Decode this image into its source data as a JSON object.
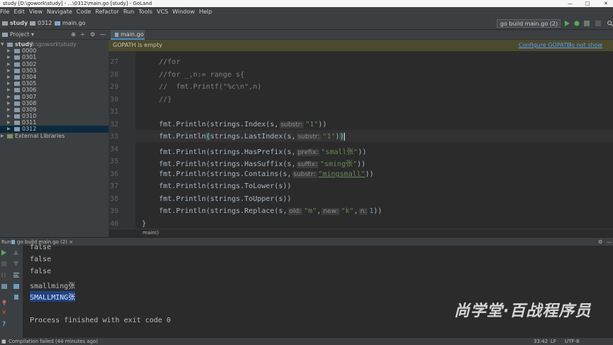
{
  "window": {
    "title": "study [D:\\gowork\\study] - ...\\0312\\main.go [study] - GoLand"
  },
  "menu": [
    "File",
    "Edit",
    "View",
    "Navigate",
    "Code",
    "Refactor",
    "Run",
    "Tools",
    "VCS",
    "Window",
    "Help"
  ],
  "breadcrumbs": {
    "project": "study",
    "folder": "0312",
    "file": "main.go"
  },
  "run_config": {
    "label": "go build main.go (2)"
  },
  "project_panel": {
    "title": "Project",
    "root_name": "study",
    "root_path": "D:\\gowork\\study",
    "folders": [
      "0000",
      "0301",
      "0302",
      "0303",
      "0304",
      "0305",
      "0306",
      "0307",
      "0308",
      "0309",
      "0310",
      "0311",
      "0312"
    ],
    "external": "External Libraries"
  },
  "editor": {
    "tab": "main.go",
    "banner": {
      "text": "GOPATH is empty",
      "configure": "Configure GOPATH",
      "dismiss": "Do not show again"
    },
    "breadcrumb": "main()",
    "line_numbers": [
      "27",
      "28",
      "29",
      "30",
      "31",
      "32",
      "33",
      "34",
      "35",
      "36",
      "37",
      "38",
      "39",
      "40"
    ]
  },
  "run_panel": {
    "label": "Run:",
    "tab": "go build main.go (2)",
    "output": [
      "false",
      "false",
      "false",
      "smallming张",
      "SMALLMING张",
      "",
      "Process finished with exit code 0"
    ]
  },
  "status": {
    "left": "Compilation failed (44 minutes ago)",
    "position": "33:42",
    "line_sep": "LF",
    "encoding": "UTF-8"
  },
  "watermark": "尚学堂·百战程序员"
}
